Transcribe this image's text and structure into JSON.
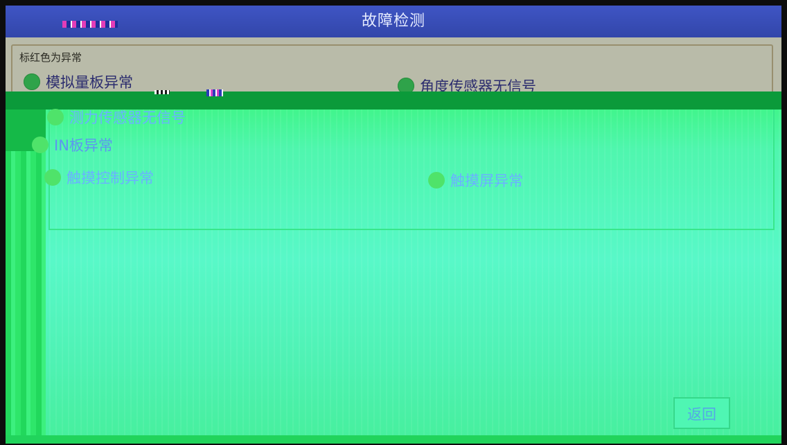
{
  "window": {
    "title": "故障检测"
  },
  "panel": {
    "legend_note": "标红色为异常"
  },
  "items": [
    {
      "label": "模拟量板异常",
      "status_color": "#2fa34a"
    },
    {
      "label": "角度传感器无信号",
      "status_color": "#2fa34a"
    },
    {
      "label": "测力传感器无信号",
      "status_color": "#4fe36a"
    },
    {
      "label": "IN板异常",
      "status_color": "#4fe36a"
    },
    {
      "label": "触摸控制异常",
      "status_color": "#4fe36a"
    },
    {
      "label": "触摸屏异常",
      "status_color": "#4fe36a"
    }
  ],
  "footer": {
    "back_label": "返回"
  },
  "colors": {
    "titlebar": "#3f55c4",
    "panel_bg": "#b9bba9",
    "glitch_green": "#4ef5b0"
  }
}
